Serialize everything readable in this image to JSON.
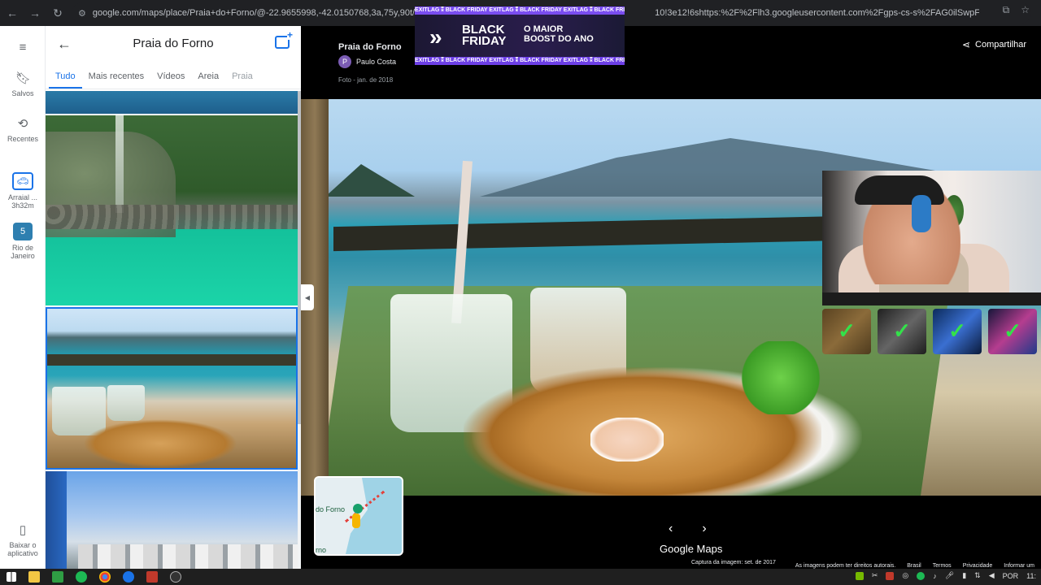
{
  "browser": {
    "url": "google.com/maps/place/Praia+do+Forno/@-22.9655998,-42.0150768,3a,75y,90t/",
    "url_tail": "10!3e12!6shttps:%2F%2Flh3.googleusercontent.com%2Fgps-cs-s%2FAG0ilSwpFQXyZVguM..."
  },
  "rail": {
    "items": [
      {
        "label": "Salvos",
        "icon": "bookmark-icon"
      },
      {
        "label": "Recentes",
        "icon": "history-icon"
      },
      {
        "label": "Arraial ...",
        "sub": "3h32m",
        "icon": "car-icon"
      },
      {
        "label": "Rio de Janeiro",
        "icon": "map-thumb-icon"
      },
      {
        "label": "Baixar o aplicativo",
        "icon": "phone-icon"
      }
    ]
  },
  "panel": {
    "title": "Praia do Forno",
    "tabs": [
      "Tudo",
      "Mais recentes",
      "Vídeos",
      "Areia",
      "Praia"
    ]
  },
  "viewer": {
    "place_name": "Praia do Forno",
    "author_initial": "P",
    "author": "Paulo Costa",
    "photo_date": "Foto - jan. de 2018",
    "share_label": "Compartilhar",
    "logo": "Google Maps",
    "capture_text": "Captura da imagem: set. de 2017",
    "footer_links": [
      "As imagens podem ter direitos autorais.",
      "Brasil",
      "Termos",
      "Privacidade",
      "Informar um"
    ],
    "minimap_label": "do Forno",
    "minimap_label2": "rno"
  },
  "overlay": {
    "strip_text": "EXITLAG ⁑ BLACK FRIDAY EXITLAG ⁑ BLACK FRIDAY EXITLAG ⁑ BLACK FRIDAY E",
    "brand_title": "BLACK FRIDAY",
    "headline": "O MAIOR BOOST DO ANO"
  },
  "taskbar": {
    "lang": "POR",
    "time": "11:"
  }
}
